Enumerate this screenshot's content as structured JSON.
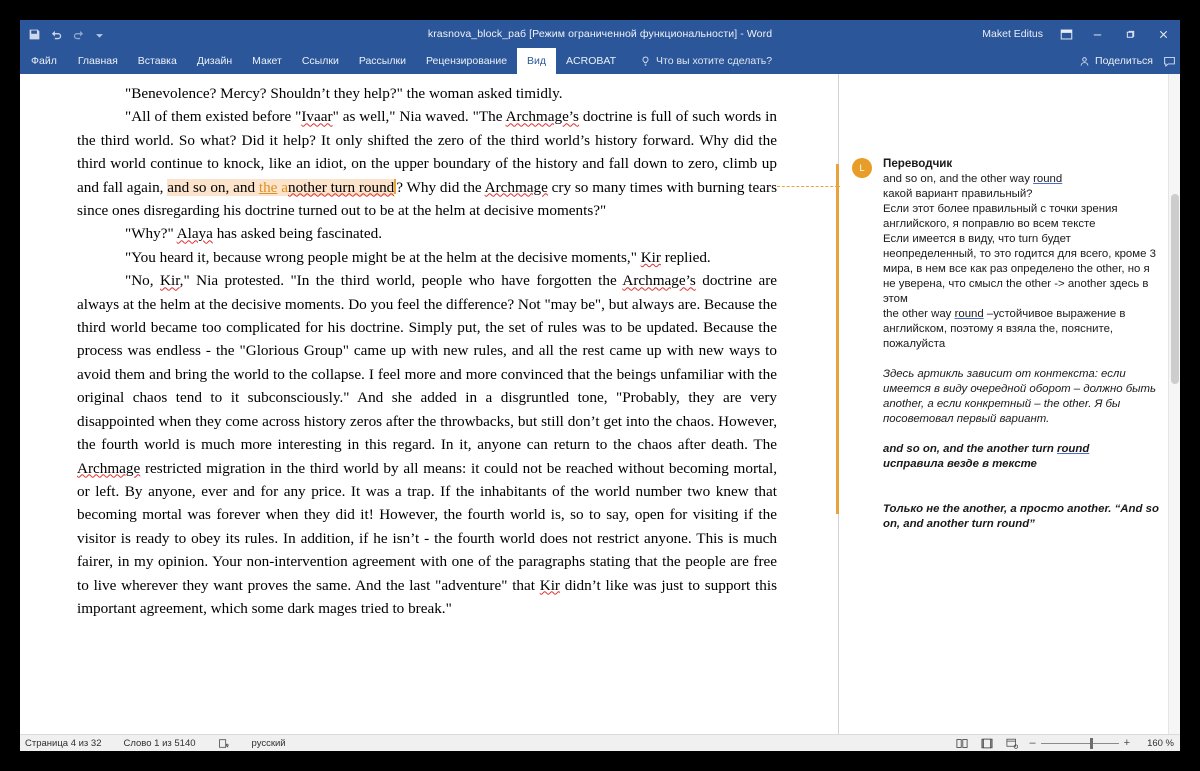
{
  "window": {
    "title": "krasnova_block_раб [Режим ограниченной функциональности]  -  Word",
    "user": "Maket Editus",
    "minimize": "—",
    "restore": "❐",
    "close": "✕"
  },
  "ribbon": {
    "tabs": [
      {
        "label": "Файл",
        "active": false
      },
      {
        "label": "Главная",
        "active": false
      },
      {
        "label": "Вставка",
        "active": false
      },
      {
        "label": "Дизайн",
        "active": false
      },
      {
        "label": "Макет",
        "active": false
      },
      {
        "label": "Ссылки",
        "active": false
      },
      {
        "label": "Рассылки",
        "active": false
      },
      {
        "label": "Рецензирование",
        "active": false
      },
      {
        "label": "Вид",
        "active": true
      },
      {
        "label": "ACROBAT",
        "active": false
      }
    ],
    "tell_me": "Что вы хотите сделать?",
    "share": "Поделиться"
  },
  "document": {
    "paragraphs": [
      "\"Benevolence? Mercy? Shouldn’t they help?\" the woman asked timidly.",
      "\"All of them existed before \"Ivaar\" as well,\" Nia waved. \"The Archmage’s doctrine is full of such words in the third world. So what? Did it help? It only shifted the zero of the third world’s history forward. Why did the third world continue to knock, like an idiot, on the upper boundary of the history and fall down to zero, climb up and fall again, and so on, and the another turn round? Why did the Archmage cry so many times with burning tears since ones disregarding his doctrine turned out to be at the helm at decisive moments?\"",
      "\"Why?\" Alaya has asked being fascinated.",
      "\"You heard it, because wrong people might be at the helm at the decisive moments,\" Kir replied.",
      "\"No, Kir,\" Nia protested. \"In the third world, people who have forgotten the Archmage’s doctrine are always at the helm at the decisive moments. Do you feel the difference? Not \"may be\", but always are. Because the third world became too complicated for his doctrine. Simply put, the set of rules was to be updated. Because the process was endless - the \"Glorious Group\" came up with new rules, and all the rest came up with new ways to avoid them and bring the world to the collapse. I feel more and more convinced that the beings unfamiliar with the original chaos tend to it subconsciously.\" And she added in a disgruntled tone, \"Probably, they are very disappointed when they come across history zeros after the throwbacks, but still don’t get into the chaos. However, the fourth world is much more interesting in this regard. In it, anyone can return to the chaos after death. The Archmage restricted migration in the third world by all means: it could not be reached without becoming mortal, or left. By anyone, ever and for any price. It was a trap. If the inhabitants of the world number two knew that becoming mortal was forever when they did it! However, the fourth world is, so to say, open for visiting if the visitor is ready to obey its rules. In addition, if he isn’t - the fourth world does not restrict anyone. This is much fairer, in my opinion. Your non-intervention agreement with one of the paragraphs stating that the people are free to live wherever they want proves the same. And the last \"adventure\" that Kir didn’t like was just to support this important agreement, which some dark mages tried to break.\""
    ],
    "fragments": {
      "p1": "\"Benevolence? Mercy? Shouldn’t they help?\" the woman asked timidly.",
      "p2_a": "\"All of them existed before \"",
      "p2_ivaar": "Ivaar",
      "p2_b": "\" as well,\" Nia waved. \"The ",
      "p2_archmage": "Archmage’s",
      "p2_c": " doctrine is full of such words in the third world. So what? Did it help? It only shifted the zero of the third world’s history forward. Why did the third world continue to knock, like an idiot, on the upper boundary of the history and fall down to zero, climb up and fall again, ",
      "p2_hl1": "and so on, and ",
      "p2_ins": "the",
      "p2_hl2": " a",
      "p2_hl3": "nother turn round",
      "p2_d": "? Why did the ",
      "p2_archmage2": "Archmage",
      "p2_e": " cry so many times with burning tears since ones disregarding his doctrine turned out to be at the helm at decisive moments?\"",
      "p3_a": "\"Why?\" ",
      "p3_alaya": "Alaya",
      "p3_b": " has asked being fascinated.",
      "p4_a": "\"You heard it, because wrong people might be at the helm at the decisive moments,\" ",
      "p4_kir": "Kir",
      "p4_b": " replied.",
      "p5_a": "\"No, ",
      "p5_kir": "Kir",
      "p5_b": ",\" Nia protested. \"In the third world, people who have forgotten the ",
      "p5_archmage": "Archmage’s",
      "p5_c": " doctrine are always at the helm at the decisive moments. Do you feel the difference? Not \"may be\", but always are. Because the third world became too complicated for his doctrine. Simply put, the set of rules was to be updated. Because the process was endless - the \"Glorious Group\" came up with new rules, and all the rest came up with new ways to avoid them and bring the world to the collapse. I feel more and more convinced that the beings unfamiliar with the original chaos tend to it subconsciously.\" And she added in a disgruntled tone, \"Probably, they are very disappointed when they come across history zeros after the throwbacks, but still don’t get into the chaos. However, the fourth world is much more interesting in this regard. In it, anyone can return to the chaos after death. The ",
      "p5_archmage2": "Archmage",
      "p5_d": " restricted migration in the third world by all means: it could not be reached without becoming mortal, or left. By anyone, ever and for any price. It was a trap. If the inhabitants of the world number two knew that becoming mortal was forever when they did it! However, the fourth world is, so to say, open for visiting if the visitor is ready to obey its rules. In addition, if he isn’t - the fourth world does not restrict anyone. This is much fairer, in my opinion. Your non-intervention agreement with one of the paragraphs stating that the people are free to live wherever they want proves the same. And the last \"adventure\" that ",
      "p5_kir2": "Kir",
      "p5_e": " didn’t like was just to support this important agreement, which some dark mages tried to break.\""
    }
  },
  "comment": {
    "avatar_initial": "L",
    "author": "Переводчик",
    "line1_a": "and so on, and the other way ",
    "line1_round": "round",
    "body1": "какой вариант правильный?\nЕсли этот более правильный с точки зрения английского, я поправлю во всем тексте\nЕсли имеется в виду, что turn будет неопределенный, то это годится для всего, кроме 3 мира, в нем все как раз определено the other, но я не уверена, что смысл the other -> another здесь в этом",
    "line2_a": "the other way ",
    "line2_round": "round",
    "line2_b": " –устойчивое выражение в английском, поэтому я взяла the, поясните, пожалуйста",
    "reply1": "Здесь артикль зависит от контекста: если имеется в виду очередной оборот – должно быть another, а если конкретный – the other. Я бы посоветовал первый вариант.",
    "reply2_a": "and so on, and the another turn ",
    "reply2_round": "round",
    "reply2_b": "исправила везде в тексте",
    "reply3": "Только не the another, а просто another. “And so on, and another turn round”"
  },
  "status": {
    "page": "Страница 4 из 32",
    "words": "Слово 1 из 5140",
    "language": "русский",
    "zoom": "160 %",
    "zoom_out": "–",
    "zoom_in": "+"
  },
  "colors": {
    "brand": "#2b579a",
    "comment_accent": "#e79d28",
    "highlight": "#fbe4cb",
    "spellcheck": "#e03030"
  }
}
